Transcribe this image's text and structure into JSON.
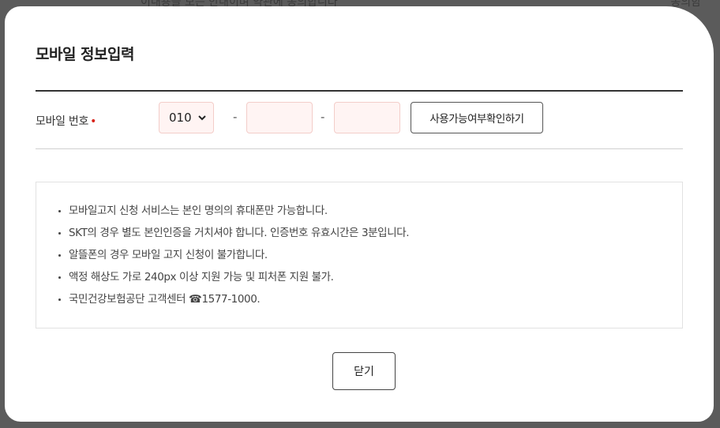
{
  "background": {
    "partial_text": "이내용을 모든 안내이며 약관에 동의합니다",
    "user_label": "동의함"
  },
  "modal": {
    "title": "모바일 정보입력",
    "mobile_label": "모바일 번호",
    "required_mark": "•",
    "carrier_prefix": {
      "selected": "010"
    },
    "dash": "-",
    "middle_number": {
      "value": ""
    },
    "last_number": {
      "value": ""
    },
    "check_button": "사용가능여부확인하기",
    "notices": [
      "모바일고지 신청 서비스는 본인 명의의 휴대폰만 가능합니다.",
      "SKT의 경우 별도 본인인증을 거치셔야 합니다. 인증번호 유효시간은 3분입니다.",
      "알뜰폰의 경우 모바일 고지 신청이 불가합니다.",
      "액정 해상도 가로 240px 이상 지원 가능 및 피처폰 지원 불가.",
      "국민건강보험공단 고객센터 ☎1577-1000."
    ],
    "close_button": "닫기"
  },
  "colors": {
    "required": "#d8231a",
    "input_bg": "#fff4f3",
    "input_border": "#f3cdc9"
  }
}
